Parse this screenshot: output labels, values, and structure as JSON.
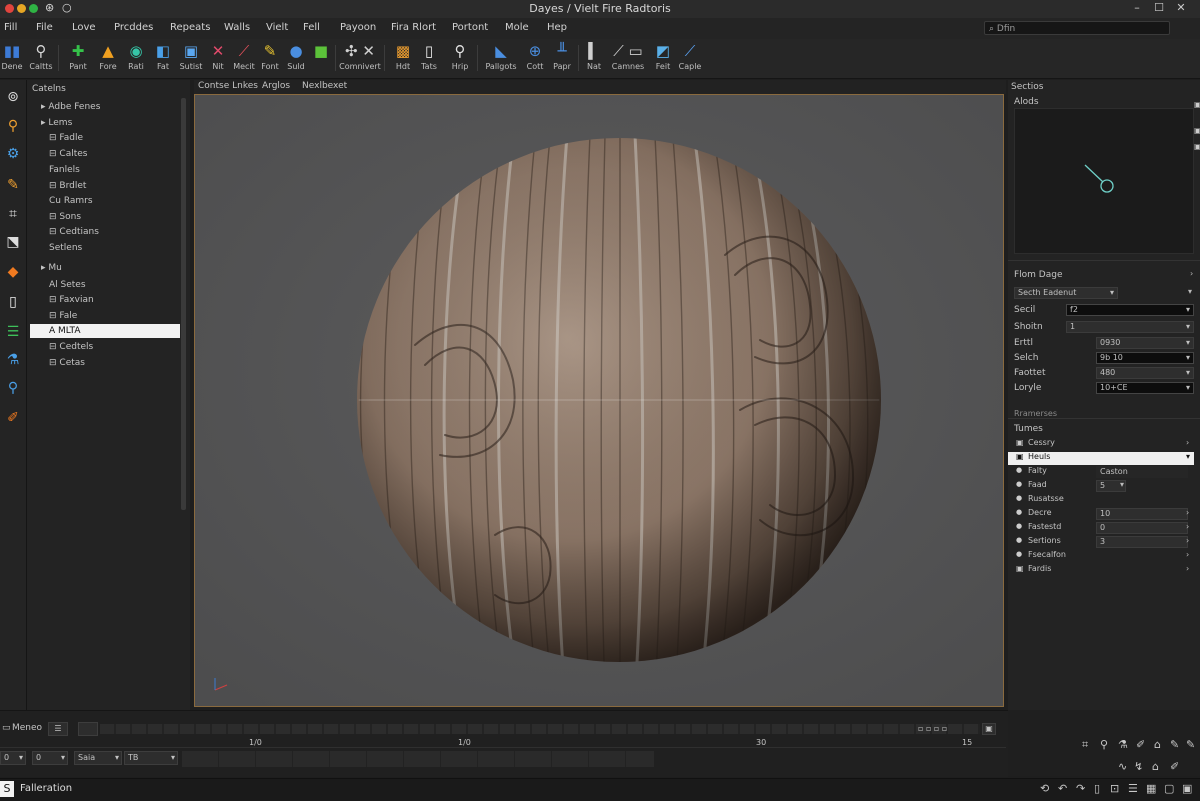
{
  "window": {
    "title": "Dayes / Vielt Fire Radtoris"
  },
  "colors": {
    "accent": "#f2f2f2",
    "viewport_border": "#8a6a3e",
    "viewport_bg": "#555556",
    "traffic_red": "#e0443e",
    "traffic_yellow": "#e6a624",
    "traffic_green": "#2fb344"
  },
  "menu": {
    "items": [
      "Fill",
      "File",
      "Love",
      "Prcddes",
      "Repeats",
      "Walls",
      "Vielt",
      "Fell",
      "Payoon",
      "Fira Rlort",
      "Portont",
      "Mole",
      "Hep"
    ],
    "search_placeholder": "Dfin"
  },
  "toolbar": {
    "tools": [
      {
        "label": "Dene",
        "icon": "rect-select-icon"
      },
      {
        "label": "Caltts",
        "icon": "brush-icon"
      },
      {
        "label": "Pant",
        "icon": "paint-icon"
      },
      {
        "label": "Fore",
        "icon": "fill-icon"
      },
      {
        "label": "Rati",
        "icon": "shape-icon"
      },
      {
        "label": "Fat",
        "icon": "select-icon"
      },
      {
        "label": "Sutist",
        "icon": "paste-icon"
      },
      {
        "label": "Nit",
        "icon": "cut-icon"
      },
      {
        "label": "Mecit",
        "icon": "pen-icon"
      },
      {
        "label": "Font",
        "icon": "text-icon"
      },
      {
        "label": "Suld",
        "icon": "globe-icon"
      },
      {
        "label": "",
        "icon": "green-cube-icon"
      },
      {
        "label": "Comnivert",
        "icon": "compose-icon"
      },
      {
        "label": "Hdt",
        "icon": "layers-icon"
      },
      {
        "label": "Tats",
        "icon": "page-icon"
      },
      {
        "label": "Hrip",
        "icon": "zoom-icon"
      },
      {
        "label": "Pallgots",
        "icon": "node-icon"
      },
      {
        "label": "Cott",
        "icon": "globe2-icon"
      },
      {
        "label": "Papr",
        "icon": "graph-icon"
      },
      {
        "label": "Nat",
        "icon": "panel-icon"
      },
      {
        "label": "Camnes",
        "icon": "camera-icon"
      },
      {
        "label": "Feit",
        "icon": "image-icon"
      },
      {
        "label": "Caple",
        "icon": "wand-icon"
      }
    ]
  },
  "outliner": {
    "header": "Catelns",
    "items": [
      {
        "label": "Adbe Fenes",
        "prefix": "▸"
      },
      {
        "label": "Lems",
        "prefix": "▸"
      },
      {
        "label": "Fadle",
        "prefix": "⊟"
      },
      {
        "label": "Caltes",
        "prefix": "⊟"
      },
      {
        "label": "Fanlels",
        "prefix": ""
      },
      {
        "label": "Brdlet",
        "prefix": "⊟"
      },
      {
        "label": "Cu Ramrs",
        "prefix": ""
      },
      {
        "label": "Sons",
        "prefix": "⊟"
      },
      {
        "label": "Cedtians",
        "prefix": "⊟"
      },
      {
        "label": "Setlens",
        "prefix": ""
      },
      {
        "label": "Mu",
        "prefix": "▸"
      },
      {
        "label": "Al Setes",
        "prefix": ""
      },
      {
        "label": "Faxvian",
        "prefix": "⊟"
      },
      {
        "label": "Fale",
        "prefix": "⊟"
      },
      {
        "label": "A MLTA",
        "prefix": "",
        "selected": true
      },
      {
        "label": "Cedtels",
        "prefix": "⊟"
      },
      {
        "label": "Cetas",
        "prefix": "⊟"
      }
    ]
  },
  "viewport": {
    "tabs": [
      "Contse Lnkes",
      "Arglos",
      "Nexlbexet"
    ]
  },
  "right_panel": {
    "preview_title": "Sectios",
    "preview_sub": "Alods",
    "props_title": "Flom Dage",
    "props_dropdown": "Secth Eadenut",
    "props": [
      {
        "label": "Secil",
        "value": "f2",
        "dark": true
      },
      {
        "label": "Shoitn",
        "value": "1",
        "dark": false
      },
      {
        "label": "Erttl",
        "value": "0930",
        "dark": false
      },
      {
        "label": "Selch",
        "value": "9b 10",
        "dark": true
      },
      {
        "label": "Faottet",
        "value": "480",
        "dark": false
      },
      {
        "label": "Loryle",
        "value": "10+CE",
        "dark": true
      }
    ],
    "subheading": "Rramerses",
    "tunes_title": "Tumes",
    "tunes": [
      {
        "label": "Cessry",
        "value": "",
        "icon": "▣"
      },
      {
        "label": "Heuls",
        "value": "",
        "icon": "▣",
        "selected": true
      },
      {
        "label": "Falty",
        "value": "Caston",
        "icon": "●"
      },
      {
        "label": "Faad",
        "value": "5",
        "icon": "●"
      },
      {
        "label": "Rusatsse",
        "value": "",
        "icon": "●"
      },
      {
        "label": "Decre",
        "value": "10",
        "icon": "●"
      },
      {
        "label": "Fastestd",
        "value": "0",
        "icon": "●"
      },
      {
        "label": "Sertions",
        "value": "3",
        "icon": "●"
      },
      {
        "label": "Fsecalfon",
        "value": "",
        "icon": "●"
      },
      {
        "label": "Fardis",
        "value": "",
        "icon": "▣"
      }
    ]
  },
  "timeline": {
    "title": "Meneo",
    "markers": [
      "1/0",
      "1/0",
      "30",
      "15"
    ],
    "fields": [
      "0",
      "0",
      "Saia",
      "TB"
    ]
  },
  "status": {
    "text": "Falleration",
    "mode_icon": "S"
  }
}
